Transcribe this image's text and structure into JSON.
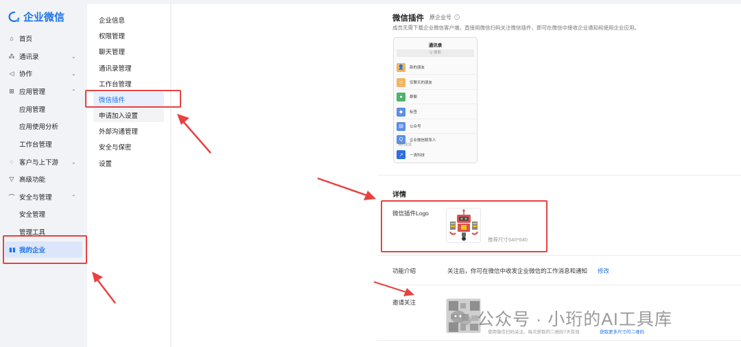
{
  "app": {
    "brand": "企业微信"
  },
  "sidebar": {
    "items": [
      {
        "label": "首页",
        "icon": "home-icon",
        "chevron": ""
      },
      {
        "label": "通讯录",
        "icon": "contacts-icon",
        "chevron": "⌄"
      },
      {
        "label": "协作",
        "icon": "send-icon",
        "chevron": "⌄"
      },
      {
        "label": "应用管理",
        "icon": "grid-icon",
        "chevron": "⌃"
      },
      {
        "label": "应用管理",
        "icon": "",
        "chevron": ""
      },
      {
        "label": "应用使用分析",
        "icon": "",
        "chevron": ""
      },
      {
        "label": "工作台管理",
        "icon": "",
        "chevron": ""
      },
      {
        "label": "客户与上下游",
        "icon": "chat-icon",
        "chevron": "⌄"
      },
      {
        "label": "高级功能",
        "icon": "filter-icon",
        "chevron": ""
      },
      {
        "label": "安全与管理",
        "icon": "umbrella-icon",
        "chevron": "⌃"
      },
      {
        "label": "安全管理",
        "icon": "",
        "chevron": ""
      },
      {
        "label": "管理工具",
        "icon": "",
        "chevron": ""
      },
      {
        "label": "我的企业",
        "icon": "company-icon",
        "chevron": ""
      }
    ]
  },
  "menu": {
    "items": [
      "企业信息",
      "权限管理",
      "聊天管理",
      "通讯录管理",
      "工作台管理",
      "微信插件",
      "申请加入设置",
      "外部沟通管理",
      "安全与保密",
      "设置"
    ]
  },
  "main": {
    "title": "微信插件",
    "tag": "原企业号",
    "info_icon": "i",
    "description": "成员无需下载企业微信客户端，直接用微信扫码关注微信插件，即可在微信中接收企业通知和使用企业应用。",
    "phone": {
      "title": "通讯录",
      "search_placeholder": "Q 搜索",
      "rows": [
        {
          "label": "新的朋友",
          "color": "#f3b463",
          "icon": "new-friend-icon"
        },
        {
          "label": "仅聊天的朋友",
          "color": "#f3b463",
          "icon": "chat-friend-icon"
        },
        {
          "label": "群聊",
          "color": "#4fb36a",
          "icon": "group-chat-icon"
        },
        {
          "label": "标签",
          "color": "#5b8fe6",
          "icon": "tag-icon"
        },
        {
          "label": "公众号",
          "color": "#5b8fe6",
          "icon": "official-account-icon"
        },
        {
          "label": "企业微信联系人",
          "color": "#5b8fe6",
          "icon": "wecom-contact-icon"
        }
      ],
      "section_label": "我的企业",
      "company_name": "一清科技",
      "company_color": "#2f6ee0"
    },
    "details_title": "详情",
    "logo_label": "微信插件Logo",
    "logo_hint": "推荐尺寸640*640",
    "feature_label": "功能介绍",
    "feature_text": "关注后，你可在微信中收发企业微信的工作消息和通知",
    "feature_link": "修改",
    "invite_label": "邀请关注",
    "invite_hint": "使用微信扫码关注，每次获取的二维码7天有效",
    "invite_link": "获取更多尺寸的二维码"
  },
  "watermark": {
    "text": "公众号 · 小珩的AI工具库"
  },
  "colors": {
    "accent": "#1e73e8",
    "annotation": "#e8413e"
  }
}
